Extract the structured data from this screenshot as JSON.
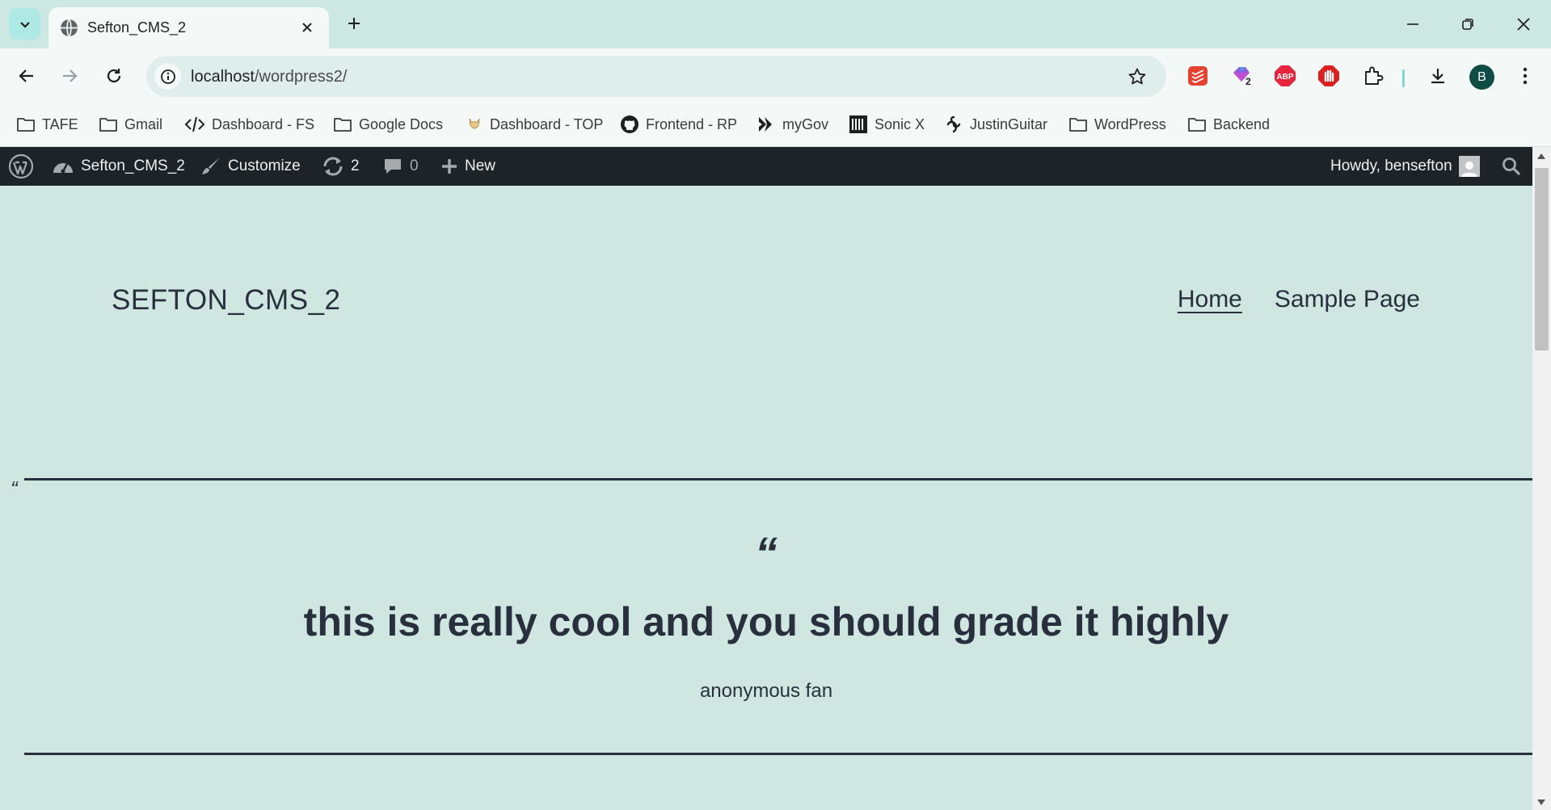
{
  "browser": {
    "tab_title": "Sefton_CMS_2",
    "url_host": "localhost",
    "url_path": "/wordpress2/",
    "profile_initial": "B",
    "extension_badge": "2",
    "bookmarks": [
      {
        "label": "TAFE",
        "icon": "folder-icon"
      },
      {
        "label": "Gmail",
        "icon": "folder-icon"
      },
      {
        "label": "Dashboard - FS",
        "icon": "code-icon"
      },
      {
        "label": "Google Docs",
        "icon": "folder-icon"
      },
      {
        "label": "Dashboard - TOP",
        "icon": "odin-icon"
      },
      {
        "label": "Frontend - RP",
        "icon": "github-icon"
      },
      {
        "label": "myGov",
        "icon": "mygov-icon"
      },
      {
        "label": "Sonic X",
        "icon": "library-icon"
      },
      {
        "label": "JustinGuitar",
        "icon": "justinguitar-icon"
      },
      {
        "label": "WordPress",
        "icon": "folder-icon"
      },
      {
        "label": "Backend",
        "icon": "folder-icon"
      }
    ]
  },
  "adminbar": {
    "site_name": "Sefton_CMS_2",
    "customize": "Customize",
    "updates_count": "2",
    "comments_count": "0",
    "new_label": "New",
    "howdy": "Howdy, bensefton"
  },
  "site": {
    "title": "SEFTON_CMS_2",
    "nav": [
      "Home",
      "Sample Page"
    ]
  },
  "quote": {
    "small_mark": "“",
    "mark": "“",
    "text": "this is really cool and you should grade it highly",
    "cite": "anonymous fan"
  },
  "colors": {
    "page_bg": "#d0e6e0",
    "adminbar_bg": "#1d2327",
    "text": "#28303d",
    "chrome_bg": "#f4f9f8",
    "tabstrip_bg": "#cde7e3"
  }
}
